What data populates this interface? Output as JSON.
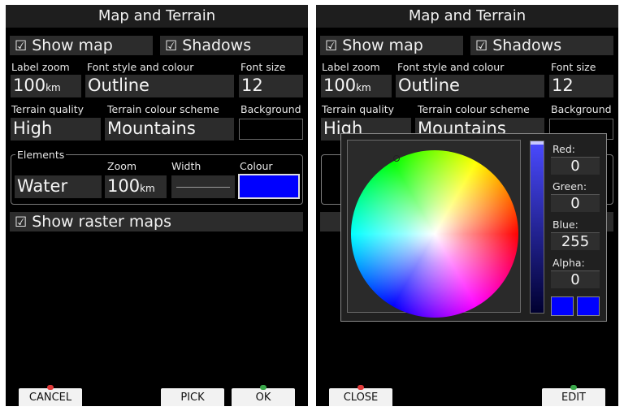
{
  "left": {
    "title": "Map and Terrain",
    "show_map": "Show map",
    "shadows": "Shadows",
    "label_zoom": {
      "label": "Label zoom",
      "value": "100",
      "unit": "km"
    },
    "font_style": {
      "label": "Font style and colour",
      "value": "Outline"
    },
    "font_size": {
      "label": "Font size",
      "value": "12"
    },
    "terrain_quality": {
      "label": "Terrain quality",
      "value": "High"
    },
    "terrain_colour": {
      "label": "Terrain colour scheme",
      "value": "Mountains"
    },
    "background": {
      "label": "Background"
    },
    "elements": {
      "group": "Elements",
      "element_value": "Water",
      "zoom_label": "Zoom",
      "zoom_value": "100",
      "zoom_unit": "km",
      "width_label": "Width",
      "colour_label": "Colour",
      "colour": "#0000ff"
    },
    "show_raster": "Show raster maps",
    "buttons": {
      "cancel": "CANCEL",
      "pick": "PICK",
      "ok": "OK"
    }
  },
  "right": {
    "title": "Map and Terrain",
    "show_map": "Show map",
    "shadows": "Shadows",
    "label_zoom": {
      "label": "Label zoom",
      "value": "100",
      "unit": "km"
    },
    "font_style": {
      "label": "Font style and colour",
      "value": "Outline"
    },
    "font_size": {
      "label": "Font size",
      "value": "12"
    },
    "terrain_quality": {
      "label": "Terrain quality",
      "value": "High"
    },
    "terrain_colour": {
      "label": "Terrain colour scheme",
      "value": "Mountains"
    },
    "background": {
      "label": "Background"
    },
    "picker": {
      "red_label": "Red:",
      "red": "0",
      "green_label": "Green:",
      "green": "0",
      "blue_label": "Blue:",
      "blue": "255",
      "alpha_label": "Alpha:",
      "alpha": "0",
      "colour": "#0000ff"
    },
    "buttons": {
      "close": "CLOSE",
      "edit": "EDIT"
    }
  },
  "check_glyph": "☑",
  "colors": {
    "accent_blue": "#0000ff",
    "cancel_marker": "#e03a3a",
    "ok_marker": "#3aa84a"
  }
}
